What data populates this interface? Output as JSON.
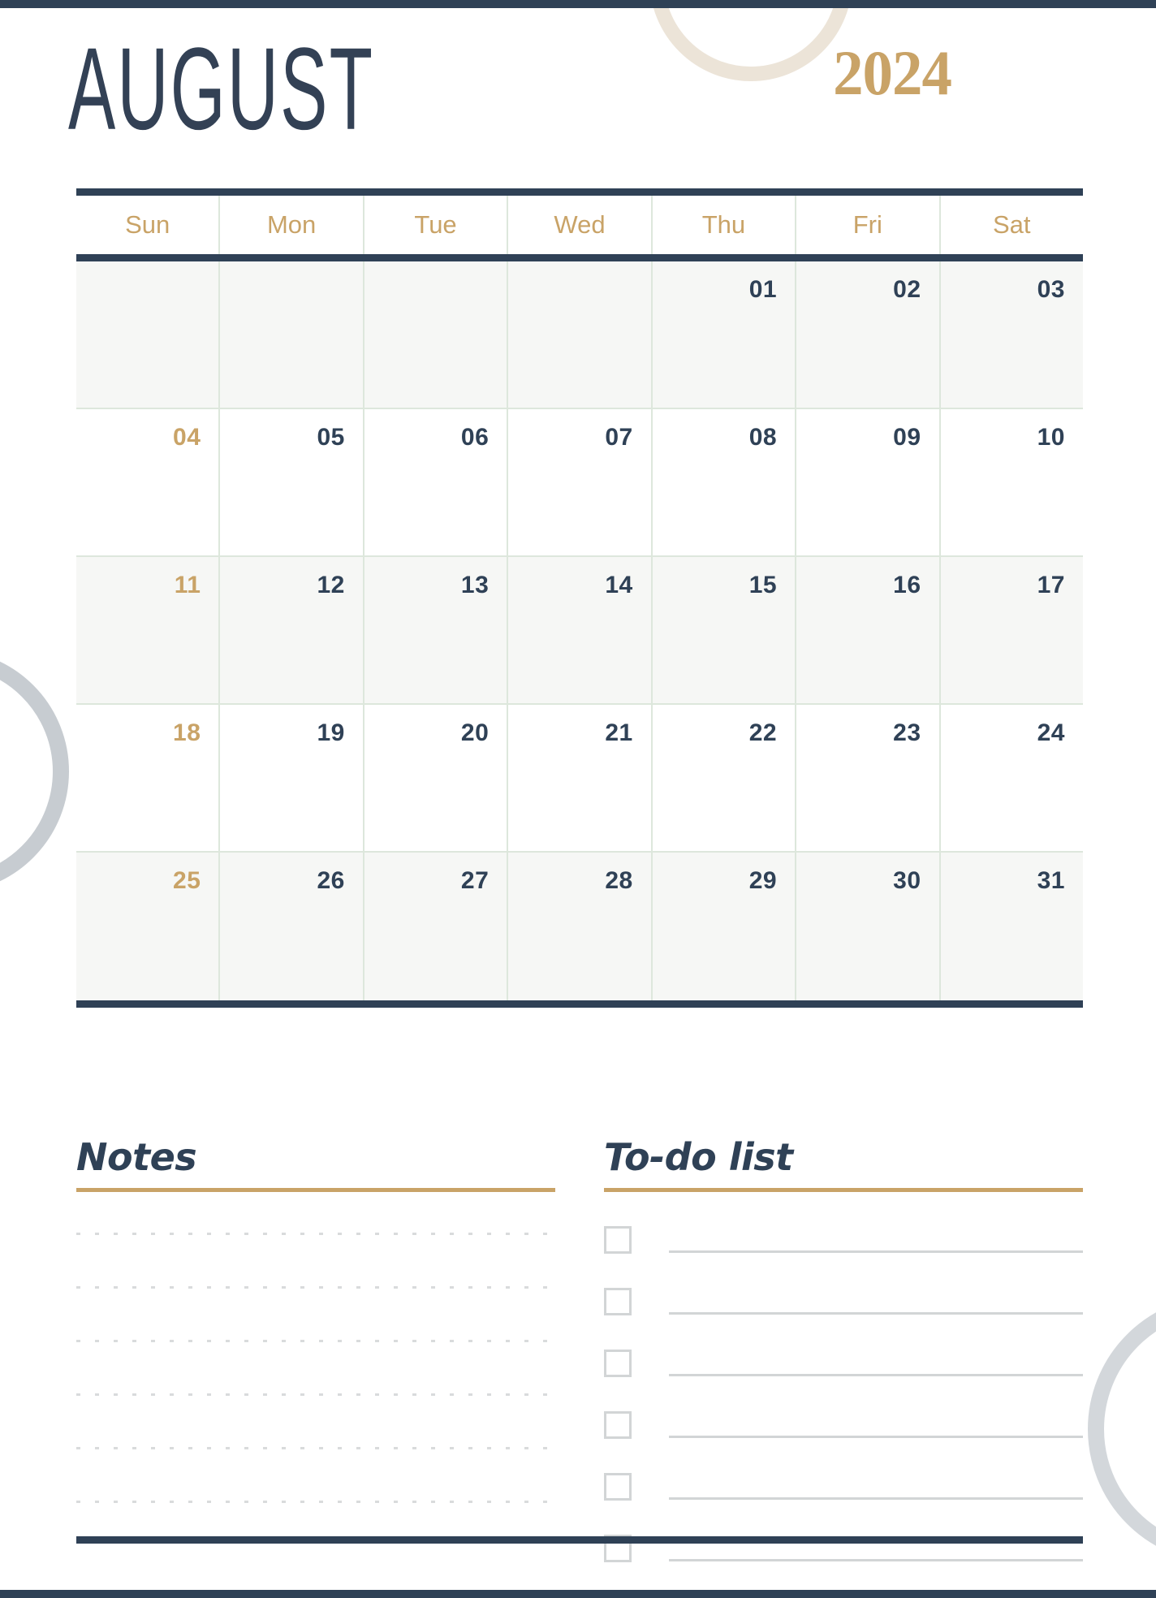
{
  "theme": {
    "navy": "#2f4156",
    "gold": "#c9a367",
    "sage_grid": "#dde7dc",
    "shaded_row": "#f6f7f5",
    "line_gray": "#d2d5d6",
    "deco_gray": "#c7ccd1",
    "deco_cream": "#ece4d8"
  },
  "header": {
    "month": "AUGUST",
    "year": "2024"
  },
  "calendar": {
    "weekdays": [
      "Sun",
      "Mon",
      "Tue",
      "Wed",
      "Thu",
      "Fri",
      "Sat"
    ],
    "weeks": [
      [
        "",
        "",
        "",
        "",
        "01",
        "02",
        "03"
      ],
      [
        "04",
        "05",
        "06",
        "07",
        "08",
        "09",
        "10"
      ],
      [
        "11",
        "12",
        "13",
        "14",
        "15",
        "16",
        "17"
      ],
      [
        "18",
        "19",
        "20",
        "21",
        "22",
        "23",
        "24"
      ],
      [
        "25",
        "26",
        "27",
        "28",
        "29",
        "30",
        "31"
      ]
    ],
    "shaded_week_indices": [
      0,
      2,
      4
    ]
  },
  "notes": {
    "title": "Notes",
    "line_count": 6
  },
  "todo": {
    "title": "To-do list",
    "item_count": 6
  }
}
